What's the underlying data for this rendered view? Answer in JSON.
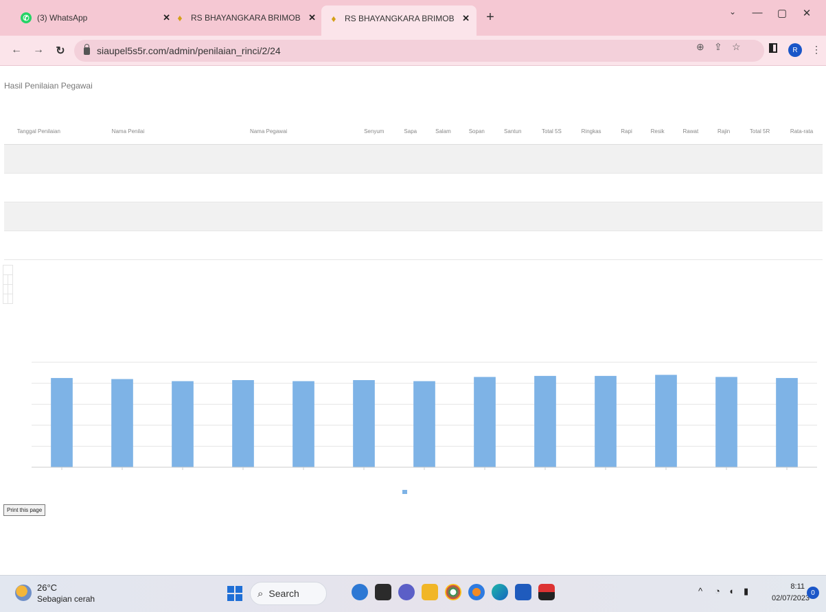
{
  "browser": {
    "tabs": [
      {
        "title": "(3) WhatsApp",
        "favicon": "whatsapp-icon",
        "active": false
      },
      {
        "title": "RS BHAYANGKARA BRIMOB KI",
        "favicon": "hospital-logo-icon",
        "active": false
      },
      {
        "title": "RS BHAYANGKARA BRIMOB KI",
        "favicon": "hospital-logo-icon",
        "active": true
      }
    ],
    "close_glyph": "✕",
    "new_tab_glyph": "+",
    "url": "siaupel5s5r.com/admin/penilaian_rinci/2/24",
    "profile_initial": "R"
  },
  "page": {
    "title": "Hasil Penilaian Pegawai",
    "columns": [
      "Tanggal Penilaian",
      "Nama Penilai",
      "Nama Pegawai",
      "Senyum",
      "Sapa",
      "Salam",
      "Sopan",
      "Santun",
      "Total 5S",
      "Ringkas",
      "Rapi",
      "Resik",
      "Rawat",
      "Rajin",
      "Total 5R",
      "Rata-rata"
    ],
    "rows": [
      {
        "date": "",
        "rater": "",
        "employee": "",
        "values": [
          "",
          "",
          "",
          "",
          "",
          "",
          "",
          "",
          "",
          "",
          "",
          "",
          ""
        ]
      },
      {
        "date": "",
        "rater": "",
        "employee": "",
        "values": [
          "",
          "",
          "",
          "",
          "",
          "",
          "",
          "",
          "",
          "",
          "",
          "",
          ""
        ]
      },
      {
        "date": "",
        "rater": "",
        "employee": "",
        "values": [
          "",
          "",
          "",
          "",
          "",
          "",
          "",
          "",
          "",
          "",
          "",
          "",
          ""
        ]
      }
    ],
    "average_row": {
      "label": "",
      "values": [
        "",
        "",
        "",
        "",
        "",
        "",
        "",
        "",
        "",
        "",
        "",
        "",
        ""
      ]
    },
    "summary": {
      "heading": "",
      "items": [
        {
          "label": "",
          "value": ""
        },
        {
          "label": "",
          "value": ""
        },
        {
          "label": "",
          "value": ""
        }
      ]
    },
    "print_button": "Print this page"
  },
  "chart_data": {
    "type": "bar",
    "title": "",
    "subtitle": "",
    "ylabel": "",
    "ylim": [
      0,
      100
    ],
    "yticks": [
      "",
      "",
      "",
      "",
      "",
      ""
    ],
    "categories": [
      "",
      "",
      "",
      "",
      "",
      "",
      "",
      "",
      "",
      "",
      "",
      "",
      ""
    ],
    "series": [
      {
        "name": "",
        "values": [
          85,
          84,
          82,
          83,
          82,
          83,
          82,
          86,
          87,
          87,
          88,
          86,
          85
        ]
      }
    ],
    "bar_color": "#7eb3e6",
    "grid": true,
    "legend": "bottom"
  },
  "taskbar": {
    "weather_temp": "26°C",
    "weather_desc": "Sebagian cerah",
    "search_placeholder": "Search",
    "time": "8:11",
    "date": "02/07/2023",
    "notification_count": "0"
  }
}
